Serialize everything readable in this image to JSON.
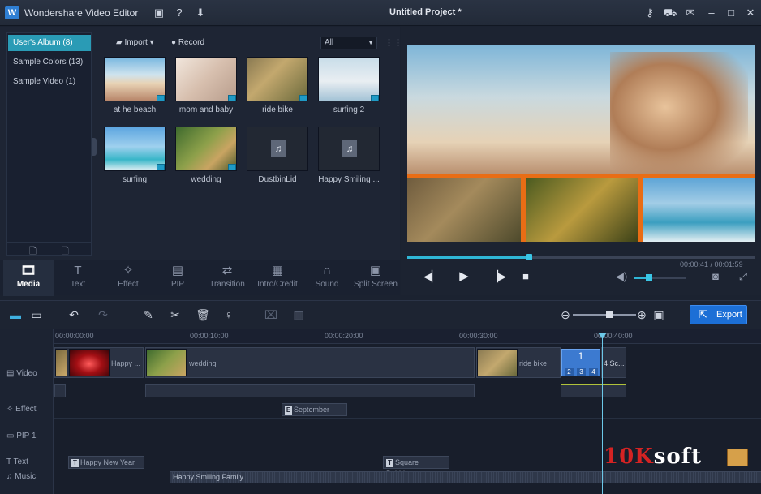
{
  "window": {
    "app_title": "Wondershare Video Editor",
    "project_title": "Untitled Project *"
  },
  "albums": [
    {
      "label": "User's Album (8)",
      "active": true
    },
    {
      "label": "Sample Colors (13)",
      "active": false
    },
    {
      "label": "Sample Video (1)",
      "active": false
    }
  ],
  "media_toolbar": {
    "import_label": "Import",
    "record_label": "Record",
    "filter_value": "All"
  },
  "media_items": [
    {
      "label": "at he beach"
    },
    {
      "label": "mom and baby"
    },
    {
      "label": "ride bike"
    },
    {
      "label": "surfing 2"
    },
    {
      "label": "surfing"
    },
    {
      "label": "wedding"
    },
    {
      "label": "DustbinLid"
    },
    {
      "label": "Happy Smiling ..."
    }
  ],
  "tabs": [
    {
      "label": "Media",
      "icon": "media-icon"
    },
    {
      "label": "Text",
      "icon": "text-icon"
    },
    {
      "label": "Effect",
      "icon": "effect-icon"
    },
    {
      "label": "PIP",
      "icon": "pip-icon"
    },
    {
      "label": "Transition",
      "icon": "transition-icon"
    },
    {
      "label": "Intro/Credit",
      "icon": "intro-credit-icon"
    },
    {
      "label": "Sound",
      "icon": "sound-icon"
    },
    {
      "label": "Split Screen",
      "icon": "split-screen-icon"
    }
  ],
  "preview": {
    "time": "00:00:41 / 00:01:59",
    "progress": 0.35,
    "volume": 0.3
  },
  "timeline": {
    "export_label": "Export",
    "ruler_labels": [
      "00:00:00:00",
      "00:00:10:00",
      "00:00:20:00",
      "00:00:30:00",
      "00:00:40:00"
    ],
    "track_labels": [
      "Video",
      "Effect",
      "PIP 1",
      "Text",
      "Music"
    ],
    "video_clips": [
      "Happy ...",
      "wedding",
      "ride bike",
      "4 Sc..."
    ],
    "split_clip": {
      "number": "1",
      "cells": [
        "2",
        "3",
        "4"
      ]
    },
    "effect_clip": "September",
    "text_clips": [
      "Happy New Year",
      "Square Bubble..."
    ],
    "music_clip": "Happy Smiling Family"
  },
  "watermark": {
    "part1": "10K",
    "part2": "soft"
  }
}
